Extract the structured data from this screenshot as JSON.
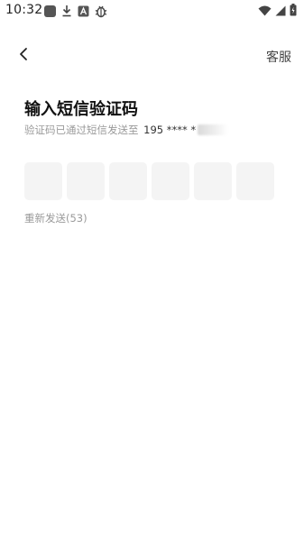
{
  "status_bar": {
    "time": "10:32",
    "left_icons": [
      "notification-square-icon",
      "download-icon",
      "a-box-icon",
      "bug-icon"
    ],
    "right_icons": [
      "wifi-icon",
      "signal-icon",
      "battery-charging-icon"
    ]
  },
  "nav": {
    "back_icon": "chevron-left-icon",
    "service_label": "客服"
  },
  "main": {
    "title": "输入短信验证码",
    "subtitle_prefix": "验证码已通过短信发送至",
    "phone_masked": "195 **** *",
    "code_length": 6,
    "resend_label": "重新发送(53)"
  },
  "colors": {
    "title": "#111111",
    "muted_text": "#9a9a9a",
    "code_box_bg": "#f4f4f4",
    "background": "#ffffff"
  }
}
